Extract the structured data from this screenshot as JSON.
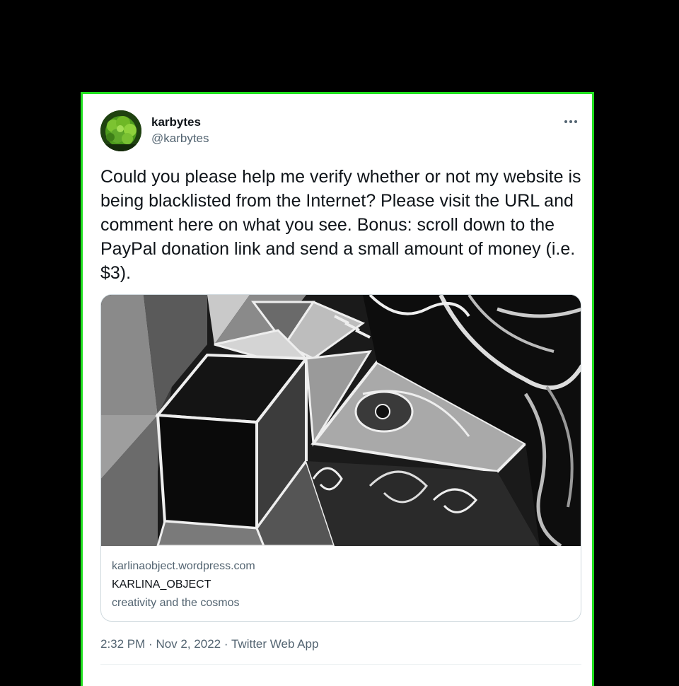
{
  "tweet": {
    "author": {
      "display_name": "karbytes",
      "handle": "@karbytes"
    },
    "more_icon": "ellipsis-icon",
    "text": "Could you please help me verify whether or not my website is being blacklisted from the Internet? Please visit the URL and comment here on what you see. Bonus: scroll down to the PayPal donation link and send a small amount of money (i.e. $3).",
    "link_card": {
      "domain": "karlinaobject.wordpress.com",
      "title": "KARLINA_OBJECT",
      "description": "creativity and the cosmos"
    },
    "time": "2:32 PM",
    "separator": "·",
    "date": "Nov 2, 2022",
    "source": "Twitter Web App"
  },
  "colors": {
    "frame_border": "#21e01f",
    "text_primary": "#0f1419",
    "text_secondary": "#536471",
    "card_border": "#cfd9de"
  }
}
